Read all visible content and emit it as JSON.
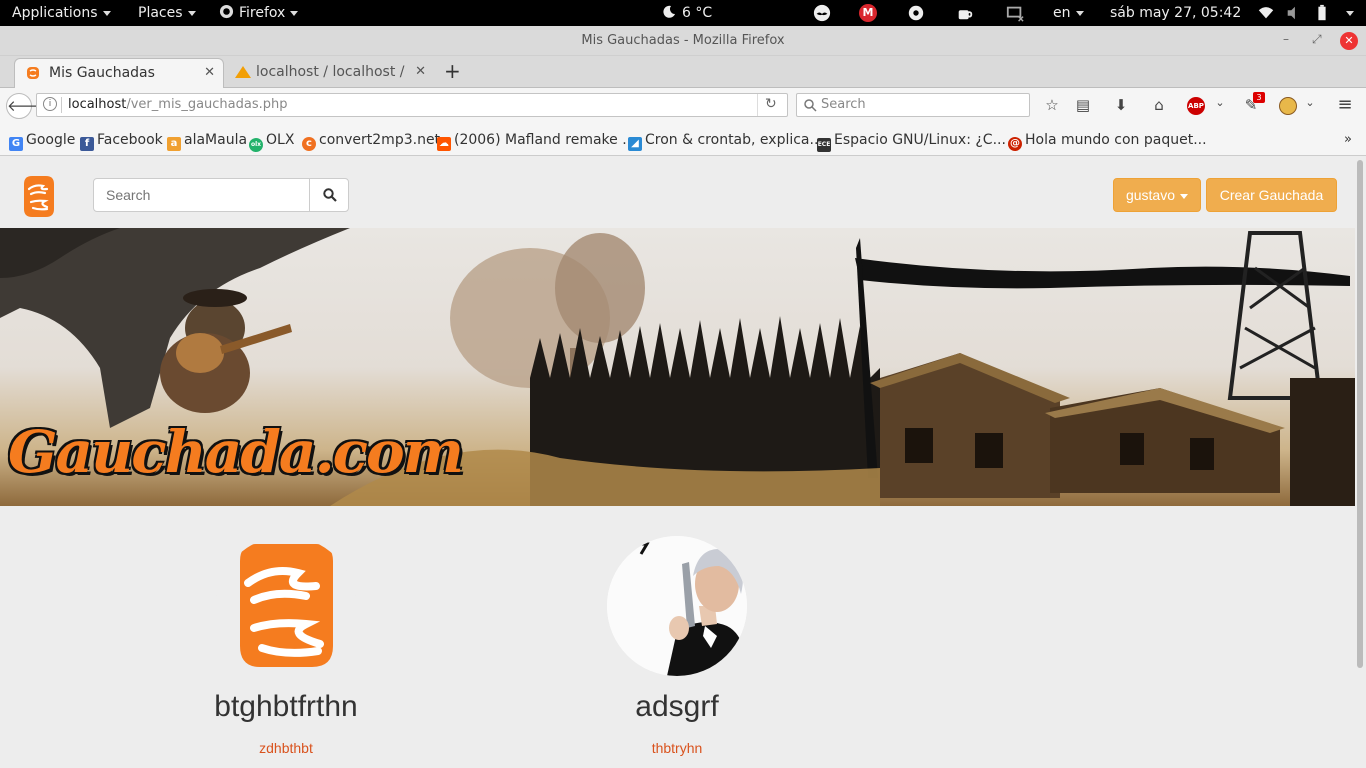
{
  "system_bar": {
    "applications": "Applications",
    "places": "Places",
    "firefox": "Firefox",
    "weather": "6 °C",
    "keyboard": "en",
    "clock": "sáb may 27, 05:42",
    "mega_badge": "M"
  },
  "window": {
    "title": "Mis Gauchadas - Mozilla Firefox"
  },
  "tabs": [
    {
      "label": "Mis Gauchadas"
    },
    {
      "label": "localhost / localhost / B"
    }
  ],
  "navbar": {
    "url_host": "localhost",
    "url_path": "/ver_mis_gauchadas.php",
    "search_placeholder": "Search",
    "abp_label": "ABP",
    "notif_count": "3"
  },
  "bookmarks": [
    {
      "label": "Google",
      "icon": "google-icon",
      "color": "#4285f4"
    },
    {
      "label": "Facebook",
      "icon": "facebook-icon",
      "color": "#3b5998"
    },
    {
      "label": "alaMaula",
      "icon": "alamaula-icon",
      "color": "#f0a030"
    },
    {
      "label": "OLX",
      "icon": "olx-icon",
      "color": "#23b26b"
    },
    {
      "label": "convert2mp3.net",
      "icon": "convert2mp3-icon",
      "color": "#f07020"
    },
    {
      "label": "(2006) Mafland remake ...",
      "icon": "soundcloud-icon",
      "color": "#ff5500"
    },
    {
      "label": "Cron & crontab, explica...",
      "icon": "cron-icon",
      "color": "#2a8ad4"
    },
    {
      "label": "Espacio GNU/Linux: ¿C...",
      "icon": "gnu-icon",
      "color": "#333333"
    },
    {
      "label": "Hola mundo con paquet...",
      "icon": "debian-icon",
      "color": "#cc2200"
    }
  ],
  "site": {
    "search_placeholder": "Search",
    "user_button": "gustavo",
    "create_button": "Crear Gauchada",
    "banner_logo_text": "Gauchada.com",
    "accent_color": "#f0ad4e"
  },
  "gauchadas": [
    {
      "title": "btghbtfrthn",
      "subtitle": "zdhbthbt",
      "image": "gauchada-logo"
    },
    {
      "title": "adsgrf",
      "subtitle": "thbtryhn",
      "image": "agent-with-pistol-photo"
    }
  ]
}
